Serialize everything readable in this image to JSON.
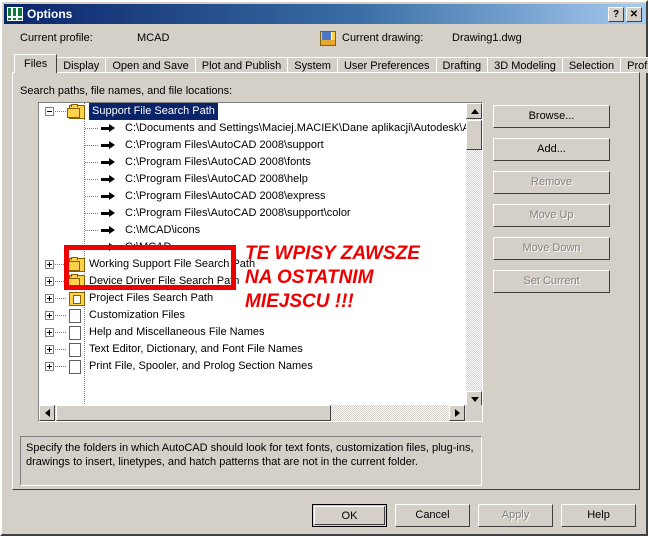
{
  "window": {
    "title": "Options",
    "icon": "autocad-options-icon",
    "help_button": "?",
    "close_button": "✕"
  },
  "header": {
    "profile_label": "Current profile:",
    "profile_value": "MCAD",
    "drawing_label": "Current drawing:",
    "drawing_value": "Drawing1.dwg",
    "drawing_icon": "drawing-file-icon"
  },
  "tabs": [
    {
      "label": "Files",
      "active": true
    },
    {
      "label": "Display",
      "active": false
    },
    {
      "label": "Open and Save",
      "active": false
    },
    {
      "label": "Plot and Publish",
      "active": false
    },
    {
      "label": "System",
      "active": false
    },
    {
      "label": "User Preferences",
      "active": false
    },
    {
      "label": "Drafting",
      "active": false
    },
    {
      "label": "3D Modeling",
      "active": false
    },
    {
      "label": "Selection",
      "active": false
    },
    {
      "label": "Profiles",
      "active": false
    }
  ],
  "panel": {
    "hint": "Search paths, file names, and file locations:"
  },
  "tree": {
    "nodes": [
      {
        "label": "Support File Search Path",
        "icon": "folders-icon",
        "state": "expanded",
        "selected": true,
        "indent": 0
      },
      {
        "label": "C:\\Documents and Settings\\Maciej.MACIEK\\Dane aplikacji\\Autodesk\\Aut",
        "icon": "arrow-icon",
        "state": "leaf",
        "selected": false,
        "indent": 1
      },
      {
        "label": "C:\\Program Files\\AutoCAD 2008\\support",
        "icon": "arrow-icon",
        "state": "leaf",
        "selected": false,
        "indent": 1
      },
      {
        "label": "C:\\Program Files\\AutoCAD 2008\\fonts",
        "icon": "arrow-icon",
        "state": "leaf",
        "selected": false,
        "indent": 1
      },
      {
        "label": "C:\\Program Files\\AutoCAD 2008\\help",
        "icon": "arrow-icon",
        "state": "leaf",
        "selected": false,
        "indent": 1
      },
      {
        "label": "C:\\Program Files\\AutoCAD 2008\\express",
        "icon": "arrow-icon",
        "state": "leaf",
        "selected": false,
        "indent": 1
      },
      {
        "label": "C:\\Program Files\\AutoCAD 2008\\support\\color",
        "icon": "arrow-icon",
        "state": "leaf",
        "selected": false,
        "indent": 1
      },
      {
        "label": "C:\\MCAD\\icons",
        "icon": "arrow-icon",
        "state": "leaf",
        "selected": false,
        "indent": 1
      },
      {
        "label": "C:\\MCAD",
        "icon": "arrow-icon",
        "state": "leaf",
        "selected": false,
        "indent": 1
      },
      {
        "label": "Working Support File Search Path",
        "icon": "folders-icon",
        "state": "collapsed",
        "selected": false,
        "indent": 0
      },
      {
        "label": "Device Driver File Search Path",
        "icon": "folders-icon",
        "state": "collapsed",
        "selected": false,
        "indent": 0
      },
      {
        "label": "Project Files Search Path",
        "icon": "project-folder-icon",
        "state": "collapsed",
        "selected": false,
        "indent": 0
      },
      {
        "label": "Customization Files",
        "icon": "document-stack-icon",
        "state": "collapsed",
        "selected": false,
        "indent": 0
      },
      {
        "label": "Help and Miscellaneous File Names",
        "icon": "document-stack-icon",
        "state": "collapsed",
        "selected": false,
        "indent": 0
      },
      {
        "label": "Text Editor, Dictionary, and Font File Names",
        "icon": "document-stack-icon",
        "state": "collapsed",
        "selected": false,
        "indent": 0
      },
      {
        "label": "Print File, Spooler, and Prolog Section Names",
        "icon": "document-stack-icon",
        "state": "collapsed",
        "selected": false,
        "indent": 0
      }
    ]
  },
  "side_buttons": [
    {
      "label": "Browse...",
      "enabled": true
    },
    {
      "label": "Add...",
      "enabled": true
    },
    {
      "label": "Remove",
      "enabled": false
    },
    {
      "label": "Move Up",
      "enabled": false
    },
    {
      "label": "Move Down",
      "enabled": false
    },
    {
      "label": "Set Current",
      "enabled": false
    }
  ],
  "description": "Specify the folders in which AutoCAD should look for text fonts, customization files, plug-ins, drawings to insert, linetypes, and hatch patterns that are not in the current folder.",
  "bottom_buttons": [
    {
      "label": "OK",
      "enabled": true,
      "default": true
    },
    {
      "label": "Cancel",
      "enabled": true,
      "default": false
    },
    {
      "label": "Apply",
      "enabled": false,
      "default": false
    },
    {
      "label": "Help",
      "enabled": true,
      "default": false
    }
  ],
  "annotation": {
    "text": "TE WPISY ZAWSZE\nNA OSTATNIM\nMIEJSCU !!!",
    "color": "#ee0000"
  }
}
